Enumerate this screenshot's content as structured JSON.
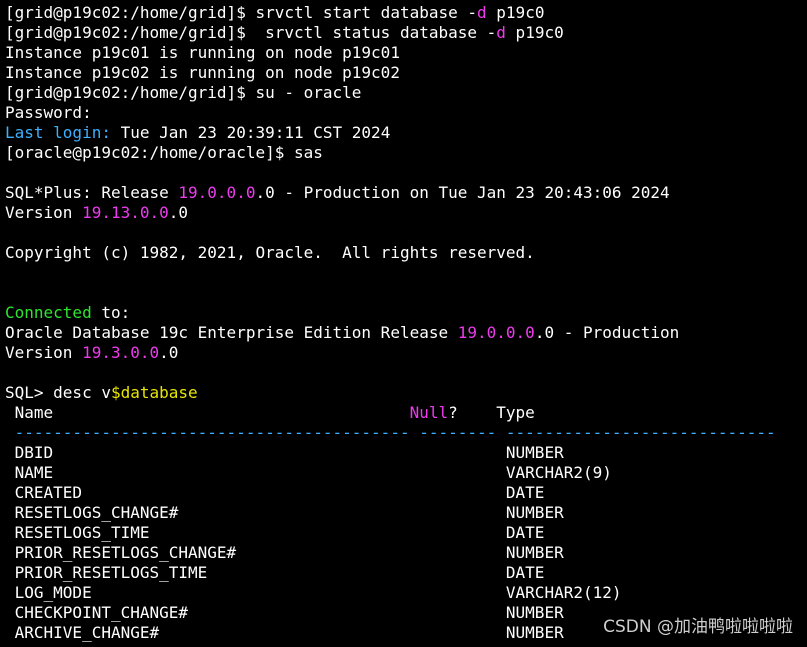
{
  "terminal": {
    "lines": [
      {
        "segments": [
          {
            "text": "[grid@p19c02:/home/grid]$ srvctl start database -",
            "color": "white"
          },
          {
            "text": "d",
            "color": "magenta"
          },
          {
            "text": " p19c0",
            "color": "white"
          }
        ]
      },
      {
        "segments": [
          {
            "text": "[grid@p19c02:/home/grid]$  srvctl status database -",
            "color": "white"
          },
          {
            "text": "d",
            "color": "magenta"
          },
          {
            "text": " p19c0",
            "color": "white"
          }
        ]
      },
      {
        "segments": [
          {
            "text": "Instance p19c01 is running on node p19c01",
            "color": "white"
          }
        ]
      },
      {
        "segments": [
          {
            "text": "Instance p19c02 is running on node p19c02",
            "color": "white"
          }
        ]
      },
      {
        "segments": [
          {
            "text": "[grid@p19c02:/home/grid]$ su - oracle",
            "color": "white"
          }
        ]
      },
      {
        "segments": [
          {
            "text": "Password:",
            "color": "white"
          }
        ]
      },
      {
        "segments": [
          {
            "text": "Last login:",
            "color": "cyan"
          },
          {
            "text": " Tue Jan 23 20:39:11 CST 2024",
            "color": "white"
          }
        ]
      },
      {
        "segments": [
          {
            "text": "[oracle@p19c02:/home/oracle]$ sas",
            "color": "white"
          }
        ]
      },
      {
        "segments": [
          {
            "text": "",
            "color": "white"
          }
        ]
      },
      {
        "segments": [
          {
            "text": "SQL*Plus: Release ",
            "color": "white"
          },
          {
            "text": "19.0.0.0",
            "color": "magenta"
          },
          {
            "text": ".0 - Production on Tue Jan 23 20:43:06 2024",
            "color": "white"
          }
        ]
      },
      {
        "segments": [
          {
            "text": "Version ",
            "color": "white"
          },
          {
            "text": "19.13.0.0",
            "color": "magenta"
          },
          {
            "text": ".0",
            "color": "white"
          }
        ]
      },
      {
        "segments": [
          {
            "text": "",
            "color": "white"
          }
        ]
      },
      {
        "segments": [
          {
            "text": "Copyright (c) 1982, 2021, Oracle.  All rights reserved.",
            "color": "white"
          }
        ]
      },
      {
        "segments": [
          {
            "text": "",
            "color": "white"
          }
        ]
      },
      {
        "segments": [
          {
            "text": "",
            "color": "white"
          }
        ]
      },
      {
        "segments": [
          {
            "text": "Connected",
            "color": "green"
          },
          {
            "text": " to:",
            "color": "white"
          }
        ]
      },
      {
        "segments": [
          {
            "text": "Oracle Database 19c Enterprise Edition Release ",
            "color": "white"
          },
          {
            "text": "19.0.0.0",
            "color": "magenta"
          },
          {
            "text": ".0 - Production",
            "color": "white"
          }
        ]
      },
      {
        "segments": [
          {
            "text": "Version ",
            "color": "white"
          },
          {
            "text": "19.3.0.0",
            "color": "magenta"
          },
          {
            "text": ".0",
            "color": "white"
          }
        ]
      },
      {
        "segments": [
          {
            "text": "",
            "color": "white"
          }
        ]
      },
      {
        "segments": [
          {
            "text": "SQL> desc v",
            "color": "white"
          },
          {
            "text": "$database",
            "color": "yellow"
          }
        ]
      },
      {
        "segments": [
          {
            "text": " Name                                     ",
            "color": "white"
          },
          {
            "text": "Null",
            "color": "magenta"
          },
          {
            "text": "?    Type",
            "color": "white"
          }
        ]
      },
      {
        "segments": [
          {
            "text": " ----------------------------------------- -------- ----------------------------",
            "color": "cyan"
          }
        ]
      },
      {
        "segments": [
          {
            "text": " DBID                                               NUMBER",
            "color": "white"
          }
        ]
      },
      {
        "segments": [
          {
            "text": " NAME                                               VARCHAR2(9)",
            "color": "white"
          }
        ]
      },
      {
        "segments": [
          {
            "text": " CREATED                                            DATE",
            "color": "white"
          }
        ]
      },
      {
        "segments": [
          {
            "text": " RESETLOGS_CHANGE#                                  NUMBER",
            "color": "white"
          }
        ]
      },
      {
        "segments": [
          {
            "text": " RESETLOGS_TIME                                     DATE",
            "color": "white"
          }
        ]
      },
      {
        "segments": [
          {
            "text": " PRIOR_RESETLOGS_CHANGE#                            NUMBER",
            "color": "white"
          }
        ]
      },
      {
        "segments": [
          {
            "text": " PRIOR_RESETLOGS_TIME                               DATE",
            "color": "white"
          }
        ]
      },
      {
        "segments": [
          {
            "text": " LOG_MODE                                           VARCHAR2(12)",
            "color": "white"
          }
        ]
      },
      {
        "segments": [
          {
            "text": " CHECKPOINT_CHANGE#                                 NUMBER",
            "color": "white"
          }
        ]
      },
      {
        "segments": [
          {
            "text": " ARCHIVE_CHANGE#                                    NUMBER",
            "color": "white"
          }
        ]
      }
    ]
  },
  "watermark": {
    "text": "CSDN @加油鸭啦啦啦啦"
  },
  "colors": {
    "background": "#000000",
    "text": "#ffffff",
    "cyan": "#3fb0ff",
    "magenta": "#ee3bee",
    "green": "#2ee62e",
    "yellow": "#e6e600"
  }
}
